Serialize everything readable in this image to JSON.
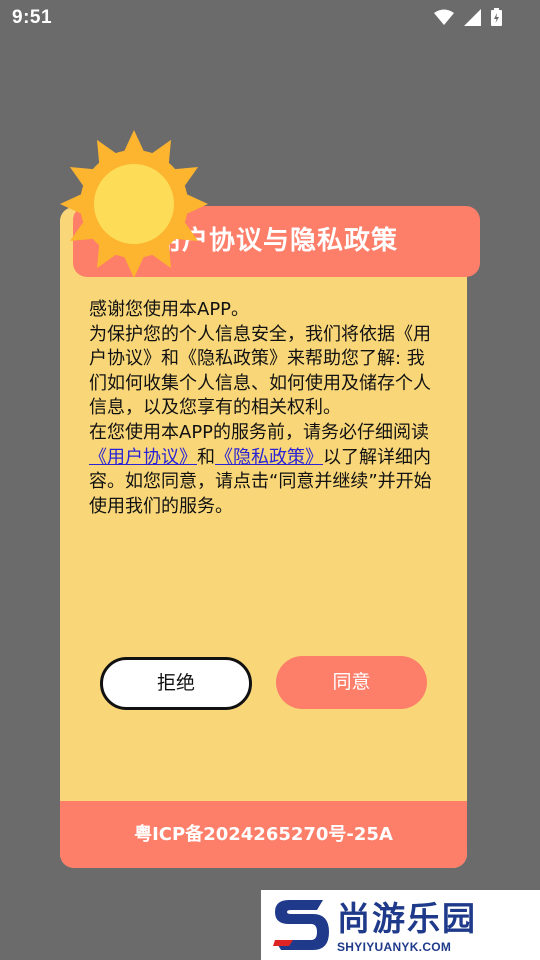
{
  "status_bar": {
    "time": "9:51",
    "icons": [
      "wifi-icon",
      "signal-icon",
      "battery-icon"
    ]
  },
  "dialog": {
    "title": "用户协议与隐私政策",
    "paragraph1": "感谢您使用本APP。",
    "paragraph2": "为保护您的个人信息安全，我们将依据《用户协议》和《隐私政策》来帮助您了解: 我们如何收集个人信息、如何使用及储存个人信息，以及您享有的相关权利。",
    "paragraph3_prefix": "在您使用本APP的服务前，请务必仔细阅读",
    "link_user_agreement": "《用户协议》",
    "paragraph3_and": "和",
    "link_privacy_policy": "《隐私政策》",
    "paragraph3_suffix": "以了解详细内容。如您同意，请点击“同意并继续”并开始使用我们的服务。",
    "refuse_label": "拒绝",
    "agree_label": "同意",
    "footer_icp": "粤ICP备2024265270号-25A"
  },
  "watermark": {
    "name_cn": "尚游乐园",
    "domain": "SHYIYUANYK.COM"
  },
  "colors": {
    "background_overlay": "#6b6b6b",
    "card": "#f9d779",
    "accent": "#fd7e69",
    "link": "#2a24d4",
    "sun_outer": "#fdb42f",
    "sun_inner": "#fddc58"
  }
}
